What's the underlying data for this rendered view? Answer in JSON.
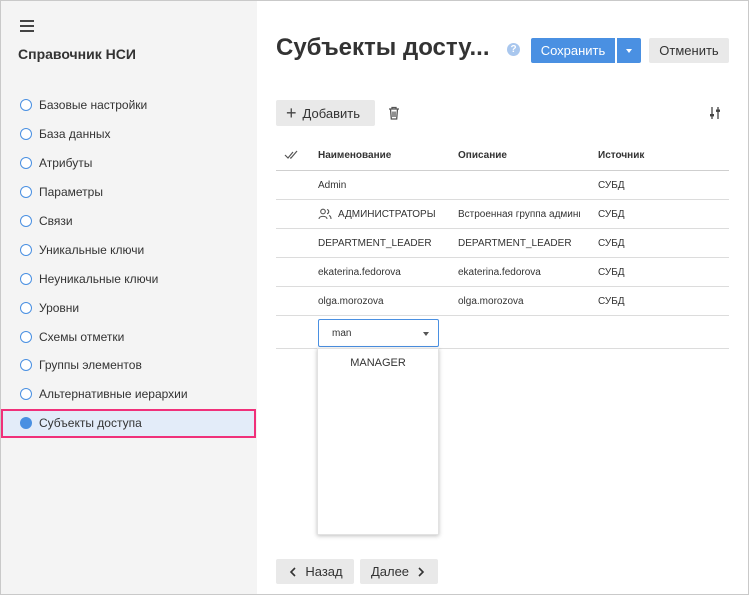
{
  "sidebar": {
    "title": "Справочник НСИ",
    "items": [
      {
        "label": "Базовые настройки",
        "active": false
      },
      {
        "label": "База данных",
        "active": false
      },
      {
        "label": "Атрибуты",
        "active": false
      },
      {
        "label": "Параметры",
        "active": false
      },
      {
        "label": "Связи",
        "active": false
      },
      {
        "label": "Уникальные ключи",
        "active": false
      },
      {
        "label": "Неуникальные ключи",
        "active": false
      },
      {
        "label": "Уровни",
        "active": false
      },
      {
        "label": "Схемы отметки",
        "active": false
      },
      {
        "label": "Группы элементов",
        "active": false
      },
      {
        "label": "Альтернативные иерархии",
        "active": false
      },
      {
        "label": "Субъекты доступа",
        "active": true
      }
    ]
  },
  "header": {
    "title": "Субъекты досту...",
    "help_icon": "?",
    "save_label": "Сохранить",
    "cancel_label": "Отменить"
  },
  "toolbar": {
    "add_label": "Добавить"
  },
  "table": {
    "columns": [
      "Наименование",
      "Описание",
      "Источник"
    ],
    "rows": [
      {
        "name": "Admin",
        "description": "",
        "source": "СУБД",
        "group": false
      },
      {
        "name": "АДМИНИСТРАТОРЫ",
        "description": "Встроенная группа админи",
        "source": "СУБД",
        "group": true
      },
      {
        "name": "DEPARTMENT_LEADER",
        "description": "DEPARTMENT_LEADER",
        "source": "СУБД",
        "group": false
      },
      {
        "name": "ekaterina.fedorova",
        "description": "ekaterina.fedorova",
        "source": "СУБД",
        "group": false
      },
      {
        "name": "olga.morozova",
        "description": "olga.morozova",
        "source": "СУБД",
        "group": false
      }
    ],
    "edit_value": "man"
  },
  "dropdown": {
    "options": [
      "MANAGER"
    ]
  },
  "footer": {
    "back_label": "Назад",
    "next_label": "Далее"
  },
  "colors": {
    "accent": "#4a90e2",
    "highlight_border": "#f0307a",
    "sidebar_bg": "#f4f4f4"
  }
}
